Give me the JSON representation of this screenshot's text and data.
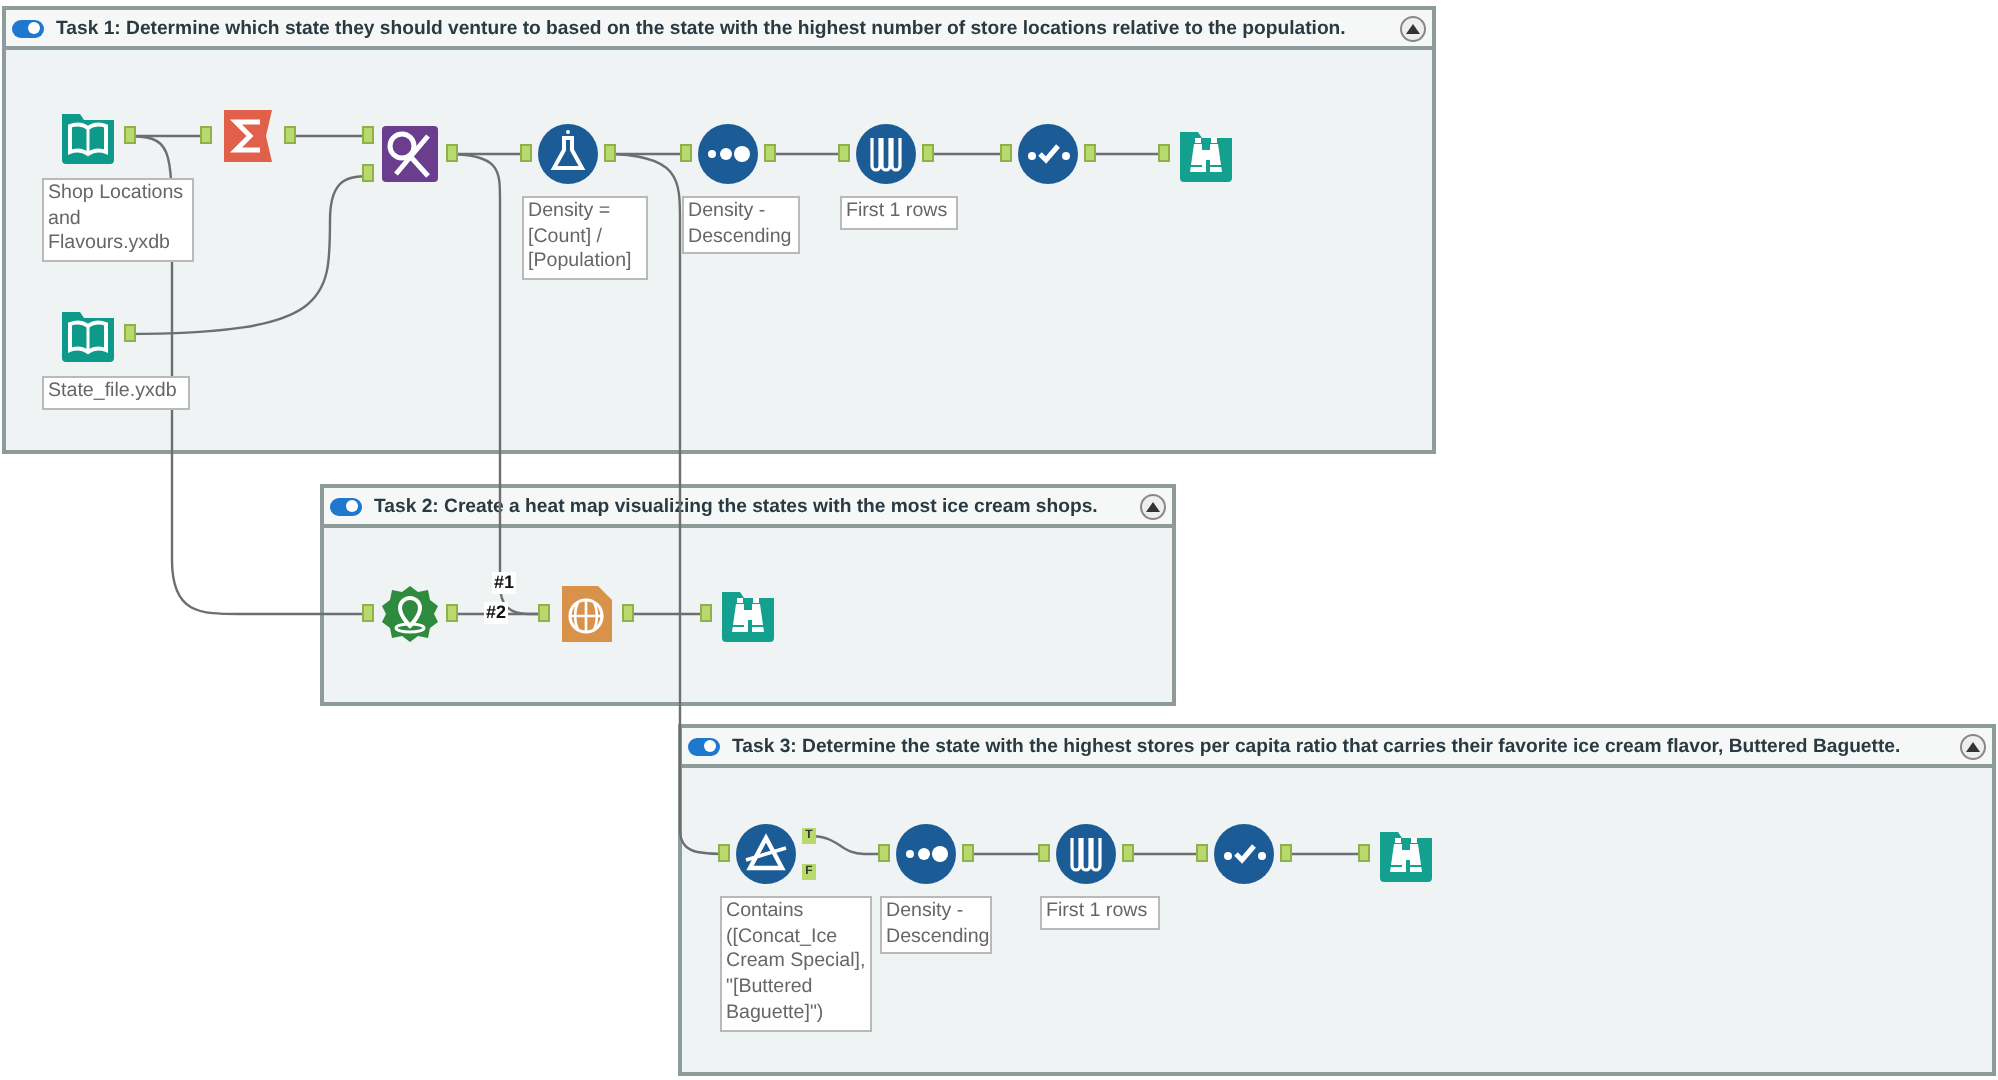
{
  "containers": [
    {
      "title": "Task 1: Determine which state they should venture to based on the state with the highest number of store locations relative to the population.",
      "enabled": true,
      "expanded": true,
      "nodes": [
        {
          "kind": "input",
          "label": "Shop Locations and Flavours.yxdb"
        },
        {
          "kind": "summarize"
        },
        {
          "kind": "join"
        },
        {
          "kind": "formula",
          "label": "Density = [Count] / [Population]"
        },
        {
          "kind": "sort",
          "label": "Density - Descending"
        },
        {
          "kind": "sample",
          "label": "First 1 rows"
        },
        {
          "kind": "select"
        },
        {
          "kind": "browse"
        },
        {
          "kind": "input",
          "label": "State_file.yxdb"
        }
      ]
    },
    {
      "title": "Task 2: Create a heat map visualizing the states with the most ice cream shops.",
      "enabled": true,
      "expanded": true,
      "connection_labels": [
        "#1",
        "#2"
      ],
      "nodes": [
        {
          "kind": "spatial"
        },
        {
          "kind": "reportmap"
        },
        {
          "kind": "browse"
        }
      ]
    },
    {
      "title": "Task 3: Determine the state with the highest stores per capita ratio that carries their favorite ice cream flavor, Buttered Baguette.",
      "enabled": true,
      "expanded": true,
      "nodes": [
        {
          "kind": "filter",
          "label": "Contains ([Concat_Ice Cream Special], \"[Buttered Baguette]\")",
          "outputs": [
            "T",
            "F"
          ]
        },
        {
          "kind": "sort",
          "label": "Density - Descending"
        },
        {
          "kind": "sample",
          "label": "First 1 rows"
        },
        {
          "kind": "select"
        },
        {
          "kind": "browse"
        }
      ]
    }
  ]
}
